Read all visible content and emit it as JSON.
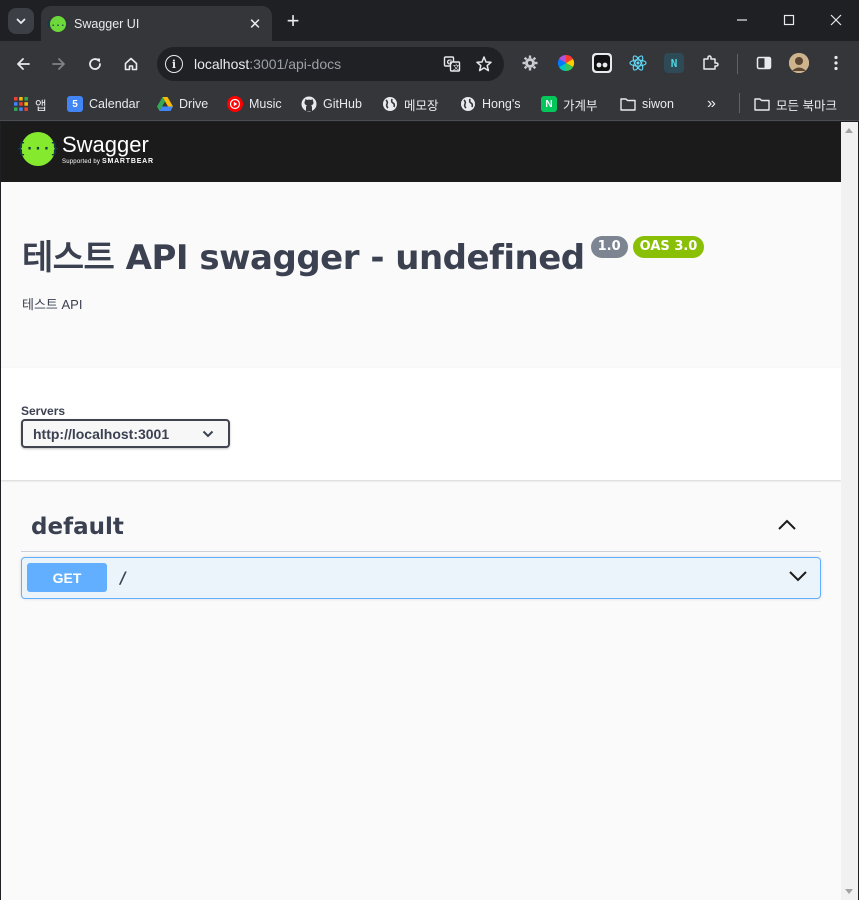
{
  "browser": {
    "tab_title": "Swagger UI",
    "tab_favicon": "{...}",
    "url_host": "localhost",
    "url_rest": ":3001/api-docs",
    "new_tab_label": "+",
    "tab_close_label": "✕"
  },
  "bookmarks": {
    "items": [
      {
        "label": "앱",
        "icon": "apps-grid-icon"
      },
      {
        "label": "Calendar",
        "icon": "calendar-icon"
      },
      {
        "label": "Drive",
        "icon": "drive-icon"
      },
      {
        "label": "Music",
        "icon": "youtube-music-icon"
      },
      {
        "label": "GitHub",
        "icon": "github-icon"
      },
      {
        "label": "메모장",
        "icon": "globe-icon"
      },
      {
        "label": "Hong's",
        "icon": "globe-icon"
      },
      {
        "label": "가계부",
        "icon": "naver-icon"
      },
      {
        "label": "siwon",
        "icon": "folder-icon"
      }
    ],
    "overflow_label": "»",
    "all_bookmarks_label": "모든 북마크"
  },
  "swagger": {
    "brand": "Swagger",
    "tagline_prefix": "Supported by",
    "tagline_brand": "SMARTBEAR",
    "title": "테스트 API swagger - undefined",
    "version": "1.0",
    "oas": "OAS 3.0",
    "description": "테스트 API",
    "servers_label": "Servers",
    "server_selected": "http://localhost:3001",
    "tag_name": "default",
    "operation": {
      "method": "GET",
      "path": "/"
    }
  },
  "colors": {
    "swagger_green": "#85ea2d",
    "get_blue": "#61affe",
    "oas_green": "#89bf04",
    "version_gray": "#7d8492",
    "topbar": "#1b1b1b"
  }
}
